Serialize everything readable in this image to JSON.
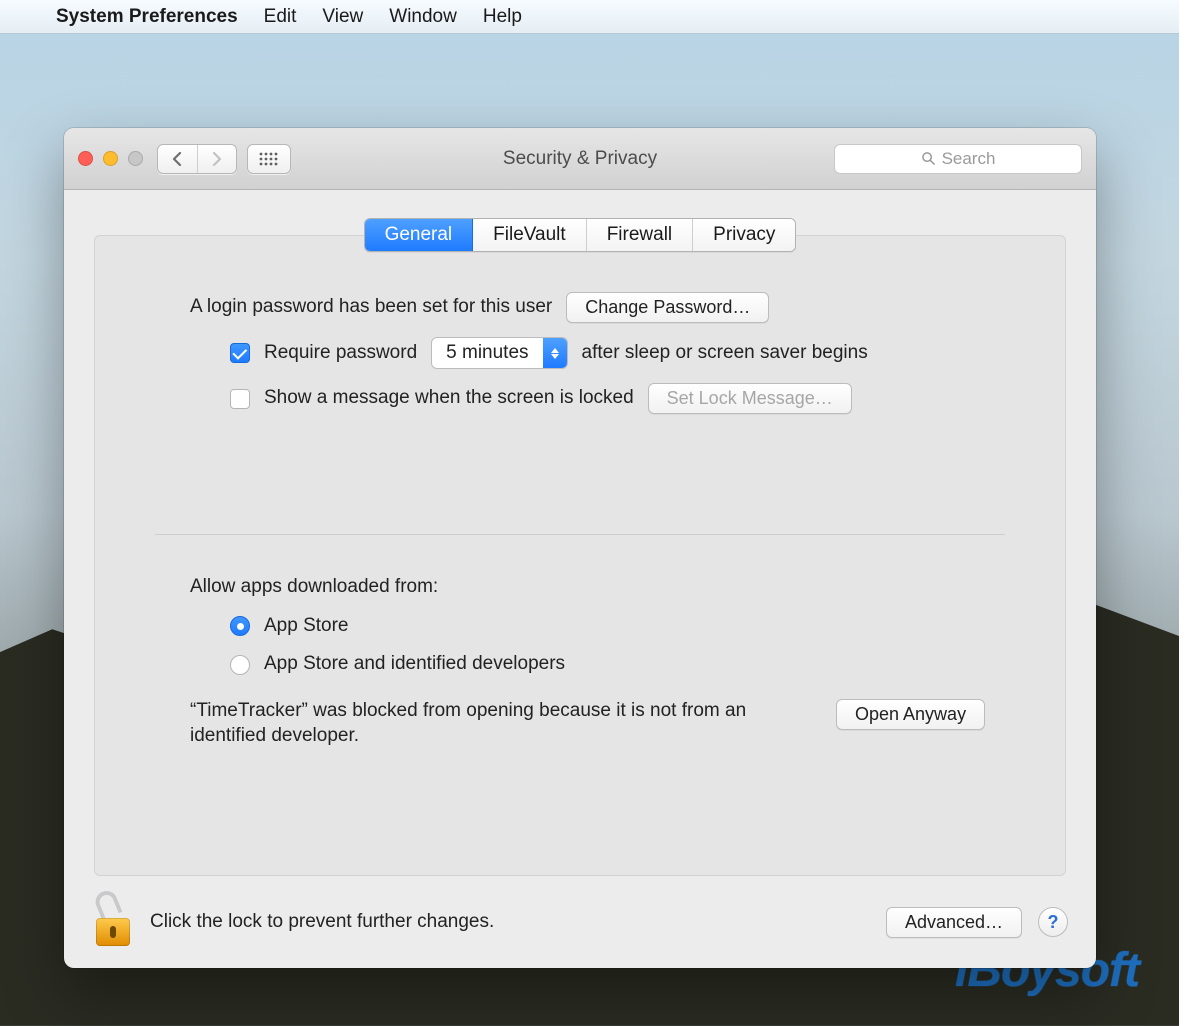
{
  "menubar": {
    "app": "System Preferences",
    "items": [
      "Edit",
      "View",
      "Window",
      "Help"
    ]
  },
  "window": {
    "title": "Security & Privacy",
    "search_placeholder": "Search"
  },
  "tabs": {
    "items": [
      "General",
      "FileVault",
      "Firewall",
      "Privacy"
    ],
    "active_index": 0
  },
  "general": {
    "login_password_text": "A login password has been set for this user",
    "change_password_button": "Change Password…",
    "require_password_checkbox_label": "Require password",
    "require_password_checked": true,
    "require_password_delay": "5 minutes",
    "require_password_suffix": "after sleep or screen saver begins",
    "show_message_checkbox_label": "Show a message when the screen is locked",
    "show_message_checked": false,
    "set_lock_message_button": "Set Lock Message…",
    "allow_apps_label": "Allow apps downloaded from:",
    "allow_apps_options": [
      {
        "label": "App Store",
        "selected": true
      },
      {
        "label": "App Store and identified developers",
        "selected": false
      }
    ],
    "blocked_app_message": "“TimeTracker” was blocked from opening because it is not from an identified developer.",
    "open_anyway_button": "Open Anyway"
  },
  "footer": {
    "lock_text": "Click the lock to prevent further changes.",
    "advanced_button": "Advanced…",
    "help": "?"
  },
  "watermark": "iBoysoft"
}
